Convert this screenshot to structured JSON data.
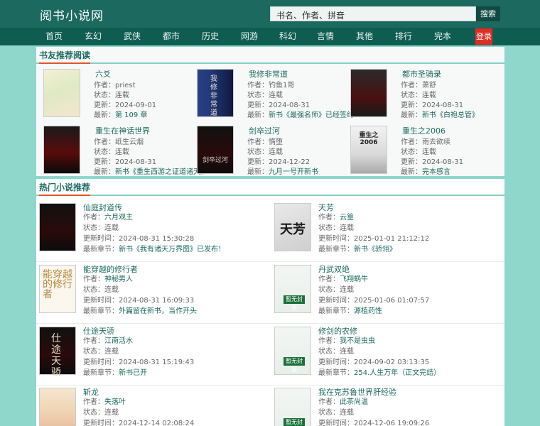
{
  "site": {
    "logo": "阅书小说网",
    "search_placeholder": "书名、作者、拼音",
    "search_button": "搜索"
  },
  "nav": {
    "items": [
      "首页",
      "玄幻",
      "武侠",
      "都市",
      "历史",
      "网游",
      "科幻",
      "言情",
      "其他",
      "排行",
      "完本"
    ],
    "login": "登录"
  },
  "recommend": {
    "heading": "书友推荐阅读",
    "labels": {
      "author": "作者：",
      "status": "状态：",
      "updated": "更新：",
      "latest": "最新："
    },
    "books": [
      {
        "title": "六爻",
        "author": "priest",
        "status": "连载",
        "updated": "2024-09-01",
        "latest": "第 109 章",
        "cover_text": ""
      },
      {
        "title": "我修非常道",
        "author": "钓鱼1哥",
        "status": "连载",
        "updated": "2024-08-31",
        "latest": "新书《最强名师》已经签约",
        "cover_text": "我修非常道"
      },
      {
        "title": "都市圣骑录",
        "author": "萧舒",
        "status": "连载",
        "updated": "2024-08-31",
        "latest": "新书《白袍总管》",
        "cover_text": ""
      },
      {
        "title": "重生在神话世界",
        "author": "纸生云烟",
        "status": "连载",
        "updated": "2024-08-31",
        "latest": "新书《重生西游之证道诸天》",
        "cover_text": ""
      },
      {
        "title": "剑卒过河",
        "author": "惰堕",
        "status": "连载",
        "updated": "2024-12-22",
        "latest": "九月一号开新书",
        "cover_text": "剑卒过河"
      },
      {
        "title": "重生之2006",
        "author": "雨去欲续",
        "status": "连载",
        "updated": "2024-08-31",
        "latest": "完本感言",
        "cover_text": "重生之2006"
      }
    ]
  },
  "hot": {
    "heading": "热门小说推荐",
    "labels": {
      "author": "作者：",
      "status": "状态：",
      "updated": "更新时间：",
      "latest": "最新章节："
    },
    "books": [
      {
        "title": "仙庭封道传",
        "author": "六月观主",
        "status": "连载",
        "updated": "2024-08-31 15:30:28",
        "latest": "新书《我有诸天万界图》已发布！"
      },
      {
        "title": "天芳",
        "author": "云篁",
        "status": "连载",
        "updated": "2025-01-01 21:12:12",
        "latest": "新书《骄翎》"
      },
      {
        "title": "能穿越的修行者",
        "author": "神秘男人",
        "status": "连载",
        "updated": "2024-08-31 16:09:33",
        "latest": "外篇留在新书，当作开头"
      },
      {
        "title": "丹武双绝",
        "author": "飞翔蜗牛",
        "status": "连载",
        "updated": "2025-01-06 01:07:57",
        "latest": "源植药性"
      },
      {
        "title": "仕途天骄",
        "author": "江南活水",
        "status": "连载",
        "updated": "2024-08-31 15:19:43",
        "latest": "新书已开"
      },
      {
        "title": "修剑的农修",
        "author": "我不是虫虫",
        "status": "连载",
        "updated": "2024-09-02 03:13:35",
        "latest": "254.人生万年（正文完结）"
      },
      {
        "title": "斩龙",
        "author": "失落叶",
        "status": "连载",
        "updated": "2024-12-14 02:08:24",
        "latest": ""
      },
      {
        "title": "我在克苏鲁世界肝经验",
        "author": "此茶尚温",
        "status": "连载",
        "updated": "2024-12-06 19:09:26",
        "latest": ""
      }
    ],
    "cover_texts": {
      "tianfang": "天芳",
      "chuanyue": "能穿越的修行者",
      "shitu": "仕途天骄",
      "no_cover": "暂无封面"
    }
  },
  "colors": {
    "page_bg": "#8fd6cb",
    "header_bg": "#1c6a5f",
    "nav_bg": "#0f5c51",
    "link": "#1c6a5f",
    "login_bg": "#e02d24"
  }
}
